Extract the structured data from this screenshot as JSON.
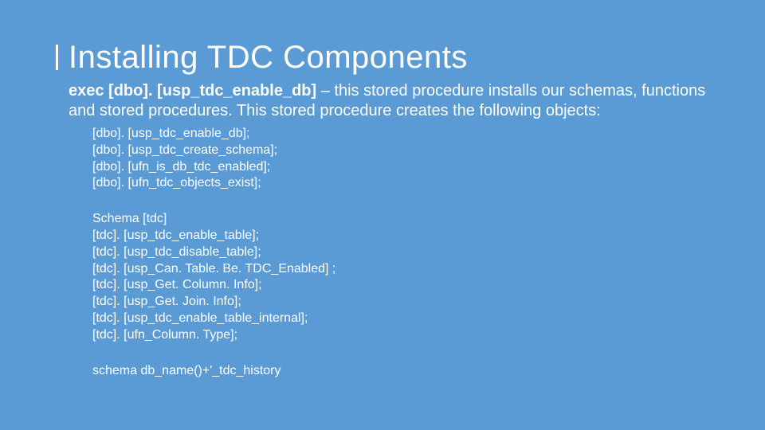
{
  "title": "Installing TDC Components",
  "intro": {
    "bold": "exec [dbo]. [usp_tdc_enable_db]",
    "rest": " – this stored procedure installs our schemas, functions and stored procedures. This stored procedure creates the following objects:"
  },
  "group1": [
    "[dbo]. [usp_tdc_enable_db];",
    "[dbo]. [usp_tdc_create_schema];",
    "[dbo]. [ufn_is_db_tdc_enabled];",
    "[dbo]. [ufn_tdc_objects_exist];"
  ],
  "group2": [
    "Schema [tdc]",
    "[tdc]. [usp_tdc_enable_table];",
    "[tdc]. [usp_tdc_disable_table];",
    "[tdc]. [usp_Can. Table. Be. TDC_Enabled] ;",
    "[tdc]. [usp_Get. Column. Info];",
    "[tdc]. [usp_Get. Join. Info];",
    "[tdc]. [usp_tdc_enable_table_internal];",
    "[tdc]. [ufn_Column. Type];"
  ],
  "group3": [
    "schema db_name()+'_tdc_history"
  ]
}
